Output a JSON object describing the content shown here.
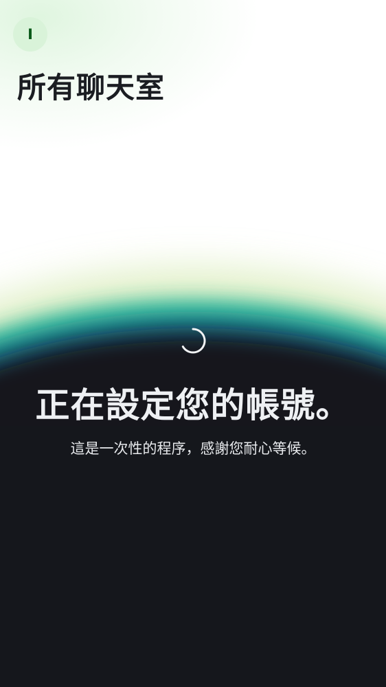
{
  "header": {
    "avatar_initial": "I",
    "title": "所有聊天室"
  },
  "loading": {
    "title": "正在設定您的帳號。",
    "subtitle": "這是一次性的程序，感謝您耐心等候。"
  },
  "colors": {
    "background_dark": "#15171c",
    "accent_green": "#d9f3d9",
    "glow_teal": "#2bb89a",
    "glow_lime": "#c9e6a8"
  }
}
